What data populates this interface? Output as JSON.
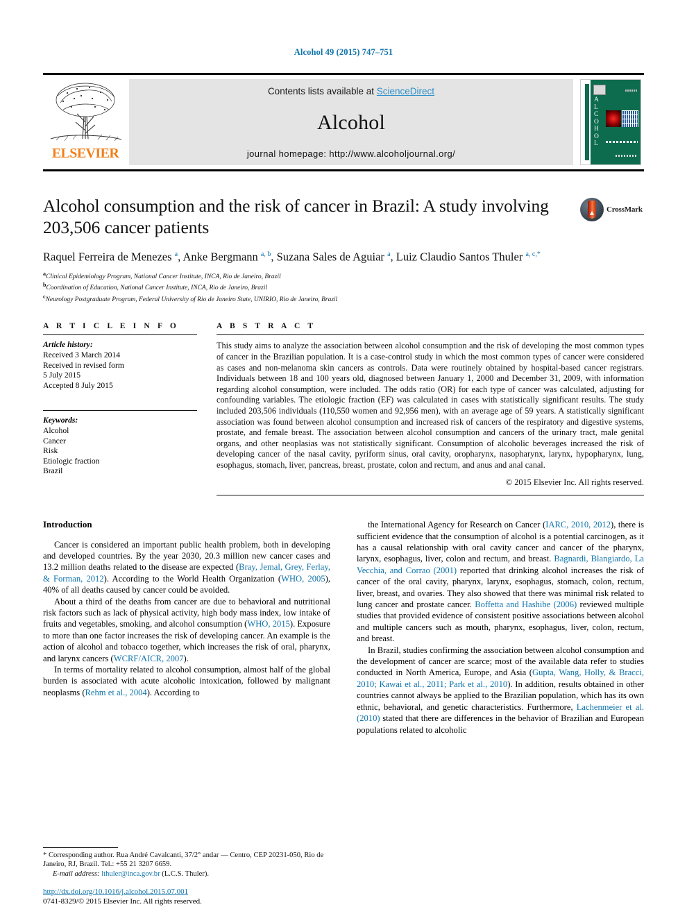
{
  "running_head": "Alcohol 49 (2015) 747–751",
  "banner": {
    "publisher": "ELSEVIER",
    "contents_prefix": "Contents lists available at ",
    "contents_link": "ScienceDirect",
    "journal_name": "Alcohol",
    "homepage": "journal homepage: http://www.alcoholjournal.org/",
    "cover_spine_letters": "A L C O H O L",
    "link_color": "#2c8fc9",
    "elsevier_orange": "#f07f1a",
    "cover_green": "#0d6b4e"
  },
  "article": {
    "title": "Alcohol consumption and the risk of cancer in Brazil: A study involving 203,506 cancer patients",
    "crossmark_label": "CrossMark",
    "authors_html": "Raquel Ferreira de Menezes <sup>a</sup>, Anke Bergmann <sup>a, b</sup>, Suzana Sales de Aguiar <sup>a</sup>, Luiz Claudio Santos Thuler <sup>a, c,</sup><sup>*</sup>",
    "affiliations": [
      {
        "mark": "a",
        "text": "Clinical Epidemiology Program, National Cancer Institute, INCA, Rio de Janeiro, Brazil"
      },
      {
        "mark": "b",
        "text": "Coordination of Education, National Cancer Institute, INCA, Rio de Janeiro, Brazil"
      },
      {
        "mark": "c",
        "text": "Neurology Postgraduate Program, Federal University of Rio de Janeiro State, UNIRIO, Rio de Janeiro, Brazil"
      }
    ]
  },
  "article_info": {
    "heading": "A R T I C L E  I N F O",
    "history_label": "Article history:",
    "history_lines": [
      "Received 3 March 2014",
      "Received in revised form",
      "5 July 2015",
      "Accepted 8 July 2015"
    ],
    "keywords_label": "Keywords:",
    "keywords": [
      "Alcohol",
      "Cancer",
      "Risk",
      "Etiologic fraction",
      "Brazil"
    ]
  },
  "abstract": {
    "heading": "A B S T R A C T",
    "text": "This study aims to analyze the association between alcohol consumption and the risk of developing the most common types of cancer in the Brazilian population. It is a case-control study in which the most common types of cancer were considered as cases and non-melanoma skin cancers as controls. Data were routinely obtained by hospital-based cancer registrars. Individuals between 18 and 100 years old, diagnosed between January 1, 2000 and December 31, 2009, with information regarding alcohol consumption, were included. The odds ratio (OR) for each type of cancer was calculated, adjusting for confounding variables. The etiologic fraction (EF) was calculated in cases with statistically significant results. The study included 203,506 individuals (110,550 women and 92,956 men), with an average age of 59 years. A statistically significant association was found between alcohol consumption and increased risk of cancers of the respiratory and digestive systems, prostate, and female breast. The association between alcohol consumption and cancers of the urinary tract, male genital organs, and other neoplasias was not statistically significant. Consumption of alcoholic beverages increased the risk of developing cancer of the nasal cavity, pyriform sinus, oral cavity, oropharynx, nasopharynx, larynx, hypopharynx, lung, esophagus, stomach, liver, pancreas, breast, prostate, colon and rectum, and anus and anal canal.",
    "copyright": "© 2015 Elsevier Inc. All rights reserved."
  },
  "introduction": {
    "heading": "Introduction",
    "left_paragraphs": [
      "Cancer is considered an important public health problem, both in developing and developed countries. By the year 2030, 20.3 million new cancer cases and 13.2 million deaths related to the disease are expected (<span class=\"ref\">Bray, Jemal, Grey, Ferlay, &amp; Forman, 2012</span>). According to the World Health Organization (<span class=\"ref\">WHO, 2005</span>), 40% of all deaths caused by cancer could be avoided.",
      "About a third of the deaths from cancer are due to behavioral and nutritional risk factors such as lack of physical activity, high body mass index, low intake of fruits and vegetables, smoking, and alcohol consumption (<span class=\"ref\">WHO, 2015</span>). Exposure to more than one factor increases the risk of developing cancer. An example is the action of alcohol and tobacco together, which increases the risk of oral, pharynx, and larynx cancers (<span class=\"ref\">WCRF/AICR, 2007</span>).",
      "In terms of mortality related to alcohol consumption, almost half of the global burden is associated with acute alcoholic intoxication, followed by malignant neoplasms (<span class=\"ref\">Rehm et al., 2004</span>). According to"
    ],
    "right_paragraphs": [
      "the International Agency for Research on Cancer (<span class=\"ref\">IARC, 2010, 2012</span>), there is sufficient evidence that the consumption of alcohol is a potential carcinogen, as it has a causal relationship with oral cavity cancer and cancer of the pharynx, larynx, esophagus, liver, colon and rectum, and breast. <span class=\"ref\">Bagnardi, Blangiardo, La Vecchia, and Corrao (2001)</span> reported that drinking alcohol increases the risk of cancer of the oral cavity, pharynx, larynx, esophagus, stomach, colon, rectum, liver, breast, and ovaries. They also showed that there was minimal risk related to lung cancer and prostate cancer. <span class=\"ref\">Boffetta and Hashibe (2006)</span> reviewed multiple studies that provided evidence of consistent positive associations between alcohol and multiple cancers such as mouth, pharynx, esophagus, liver, colon, rectum, and breast.",
      "In Brazil, studies confirming the association between alcohol consumption and the development of cancer are scarce; most of the available data refer to studies conducted in North America, Europe, and Asia (<span class=\"ref\">Gupta, Wang, Holly, &amp; Bracci, 2010; Kawai et al., 2011; Park et al., 2010</span>). In addition, results obtained in other countries cannot always be applied to the Brazilian population, which has its own ethnic, behavioral, and genetic characteristics. Furthermore, <span class=\"ref\">Lachenmeier et al. (2010)</span> stated that there are differences in the behavior of Brazilian and European populations related to alcoholic"
    ]
  },
  "footnote": {
    "corresponding": "* Corresponding author. Rua André Cavalcanti, 37/2° andar — Centro, CEP 20231-050, Rio de Janeiro, RJ, Brazil. Tel.: +55 21 3207 6659.",
    "email_label": "E-mail address:",
    "email": "lthuler@inca.gov.br",
    "email_owner": "(L.C.S. Thuler)."
  },
  "doi": {
    "url": "http://dx.doi.org/10.1016/j.alcohol.2015.07.001",
    "issn_line": "0741-8329/© 2015 Elsevier Inc. All rights reserved."
  }
}
